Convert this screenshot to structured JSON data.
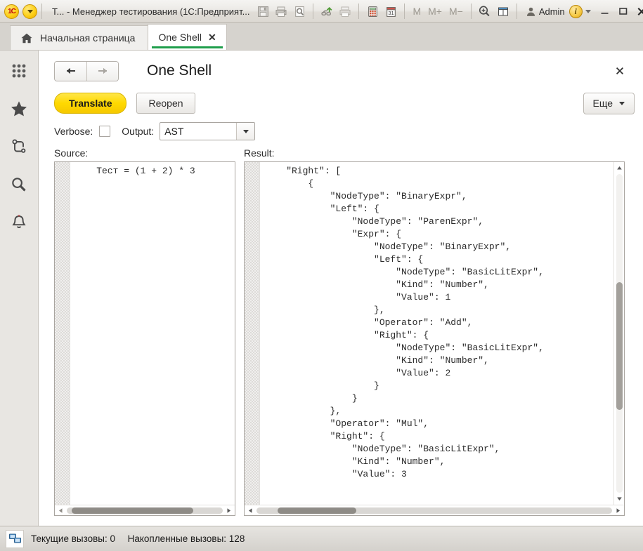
{
  "window": {
    "title": "Т... - Менеджер тестирования (1С:Предприят...",
    "logo_text": "1C",
    "icons": {
      "dropdown": "dropdown-arrow-icon",
      "save": "save-icon",
      "print": "print-icon",
      "preview": "print-preview-icon",
      "link": "link-icon",
      "printer2": "printer-disabled-icon",
      "calculator": "calculator-icon",
      "calendar": "calendar-icon",
      "zoom": "magnifier-plus-icon",
      "panels": "panels-icon",
      "user": "user-icon",
      "info": "info-icon"
    },
    "memory_buttons": [
      "M",
      "M+",
      "M−"
    ],
    "user_label": "Admin",
    "minimize_label": "—",
    "maximize_label": "□",
    "close_label": "✕"
  },
  "tabs": [
    {
      "label": "Начальная страница",
      "icon": "home-icon",
      "active": false,
      "closable": false
    },
    {
      "label": "One Shell",
      "icon": "",
      "active": true,
      "closable": true,
      "close_label": "✕"
    }
  ],
  "sidebar": {
    "items": [
      {
        "name": "sidebar-item-functions",
        "icon": "grid-dots-icon"
      },
      {
        "name": "sidebar-item-favorites",
        "icon": "star-icon"
      },
      {
        "name": "sidebar-item-links",
        "icon": "link-node-icon"
      },
      {
        "name": "sidebar-item-search",
        "icon": "search-icon"
      },
      {
        "name": "sidebar-item-notifications",
        "icon": "bell-icon"
      }
    ]
  },
  "form": {
    "title": "One Shell",
    "nav": {
      "back_icon": "arrow-left-icon",
      "forward_icon": "arrow-right-icon"
    },
    "close_label": "✕"
  },
  "commandbar": {
    "translate_label": "Translate",
    "reopen_label": "Reopen",
    "more_label": "Еще",
    "more_caret_icon": "chevron-down-icon"
  },
  "options": {
    "verbose_label": "Verbose:",
    "verbose_checked": false,
    "output_label": "Output:",
    "output_value": "AST",
    "output_options": [
      "AST"
    ],
    "dropdown_icon": "chevron-down-icon"
  },
  "source_pane": {
    "label": "Source:",
    "text": "    Тест = (1 + 2) * 3",
    "hscroll": {
      "left_arrow": "◀",
      "right_arrow": "▶",
      "thumb_left_pct": 3,
      "thumb_width_pct": 78
    }
  },
  "result_pane": {
    "label": "Result:",
    "text": "    \"Right\": [\n        {\n            \"NodeType\": \"BinaryExpr\",\n            \"Left\": {\n                \"NodeType\": \"ParenExpr\",\n                \"Expr\": {\n                    \"NodeType\": \"BinaryExpr\",\n                    \"Left\": {\n                        \"NodeType\": \"BasicLitExpr\",\n                        \"Kind\": \"Number\",\n                        \"Value\": 1\n                    },\n                    \"Operator\": \"Add\",\n                    \"Right\": {\n                        \"NodeType\": \"BasicLitExpr\",\n                        \"Kind\": \"Number\",\n                        \"Value\": 2\n                    }\n                }\n            },\n            \"Operator\": \"Mul\",\n            \"Right\": {\n                \"NodeType\": \"BasicLitExpr\",\n                \"Kind\": \"Number\",\n                \"Value\": 3",
    "vscroll": {
      "up_arrow": "▲",
      "down_arrow": "▼",
      "thumb_top_pct": 34,
      "thumb_height_pct": 40
    },
    "hscroll": {
      "left_arrow": "◀",
      "right_arrow": "▶",
      "thumb_left_pct": 6,
      "thumb_width_pct": 22
    }
  },
  "statusbar": {
    "icon": "network-computers-icon",
    "current_calls_label": "Текущие вызовы:",
    "current_calls_value": "0",
    "total_calls_label": "Накопленные вызовы:",
    "total_calls_value": "128"
  },
  "colors": {
    "accent_yellow": "#ffd900",
    "tab_underline_green": "#1f9e4b",
    "window_chrome": "#d6d3ce"
  }
}
